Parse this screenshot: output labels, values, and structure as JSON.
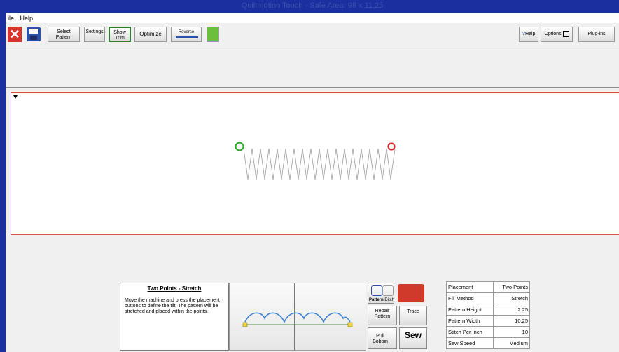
{
  "titlebar": {
    "text": "Quiltmotion Touch - Safe Area: 98 x 11.25"
  },
  "menu": [
    "ile",
    "Help"
  ],
  "toolbar": {
    "select_pattern": "Select Pattern",
    "settings": "Settings",
    "show_trim": "Show Trim",
    "optimize": "Optimize",
    "reverse": "Reverse",
    "help": "Help",
    "options": "Options",
    "plugins": "Plug-ins"
  },
  "instructions": {
    "title": "Two Points - Stretch",
    "body": "Move the machine and press the placement buttons to define the tilt. The pattern will be stretched and placed within the points."
  },
  "buttons": {
    "pattern": "Pattern",
    "ditch": "Ditch",
    "repair_pattern": "Repair Pattern",
    "trace": "Trace",
    "pull_bobbin": "Pull Bobbin",
    "sew": "Sew"
  },
  "properties": [
    {
      "label": "Placement",
      "value": "Two Points"
    },
    {
      "label": "Fill Method",
      "value": "Stretch"
    },
    {
      "label": "Pattern Height",
      "value": "2.25"
    },
    {
      "label": "Pattern Width",
      "value": "10.25"
    },
    {
      "label": "Stitch Per Inch",
      "value": "10"
    },
    {
      "label": "Sew Speed",
      "value": "Medium"
    }
  ],
  "colors": {
    "window_frame": "#1b2f9e",
    "start_point": "#22b022",
    "end_point": "#e02020",
    "boundary_line": "#e05050"
  }
}
